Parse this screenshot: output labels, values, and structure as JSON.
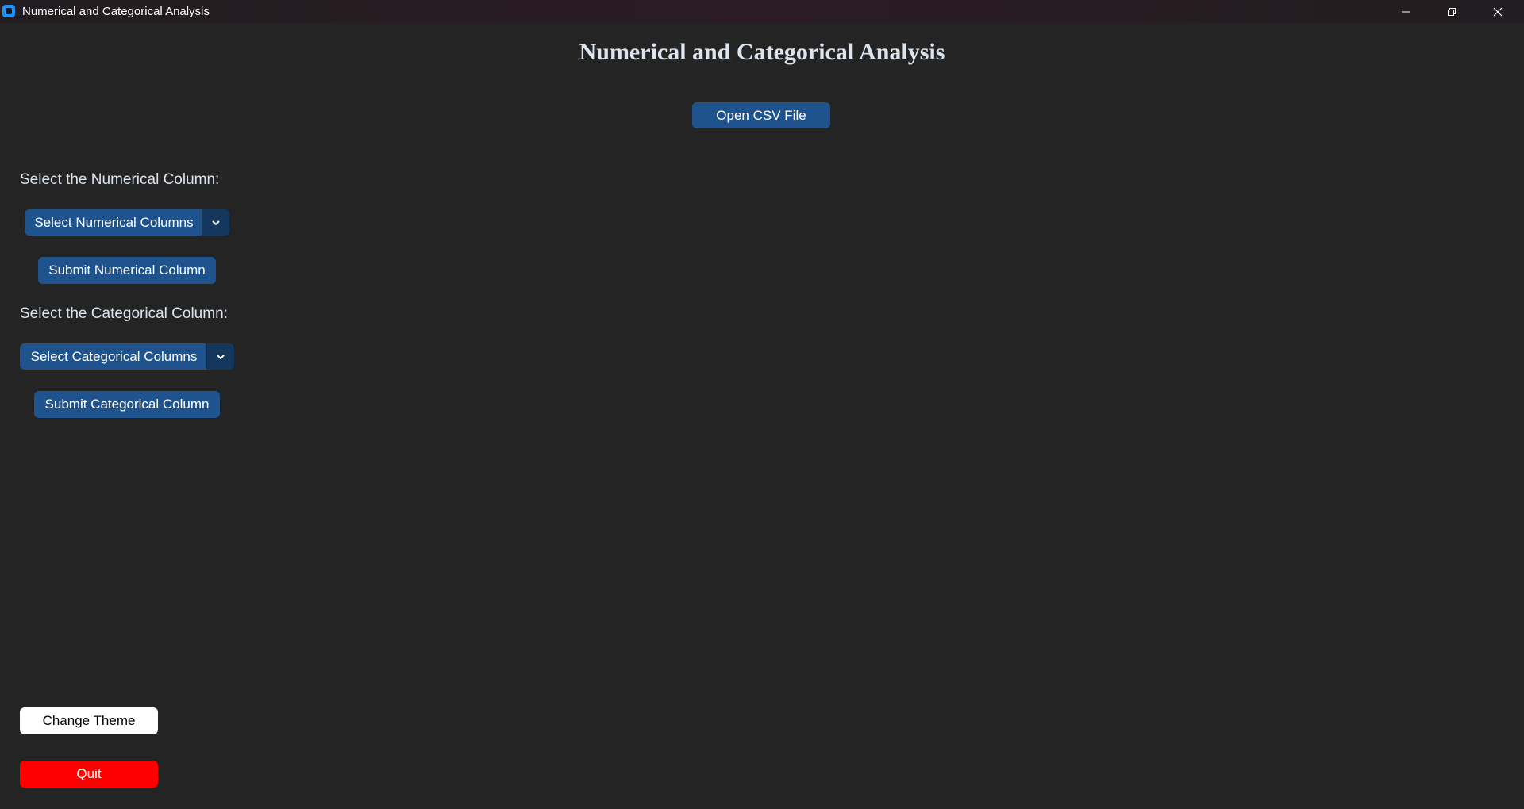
{
  "window": {
    "title": "Numerical and Categorical Analysis"
  },
  "header": {
    "title": "Numerical and Categorical Analysis"
  },
  "toolbar": {
    "open_csv_label": "Open CSV File"
  },
  "numerical": {
    "label": "Select the Numerical Column:",
    "dropdown_value": "Select Numerical Columns",
    "submit_label": "Submit Numerical Column"
  },
  "categorical": {
    "label": "Select the Categorical Column:",
    "dropdown_value": "Select Categorical Columns",
    "submit_label": "Submit Categorical Column"
  },
  "footer": {
    "change_theme_label": "Change Theme",
    "quit_label": "Quit"
  },
  "colors": {
    "background": "#242424",
    "accent": "#1f538d",
    "accent_dark": "#14375e",
    "quit": "#ff0000",
    "theme_button": "#ffffff"
  }
}
